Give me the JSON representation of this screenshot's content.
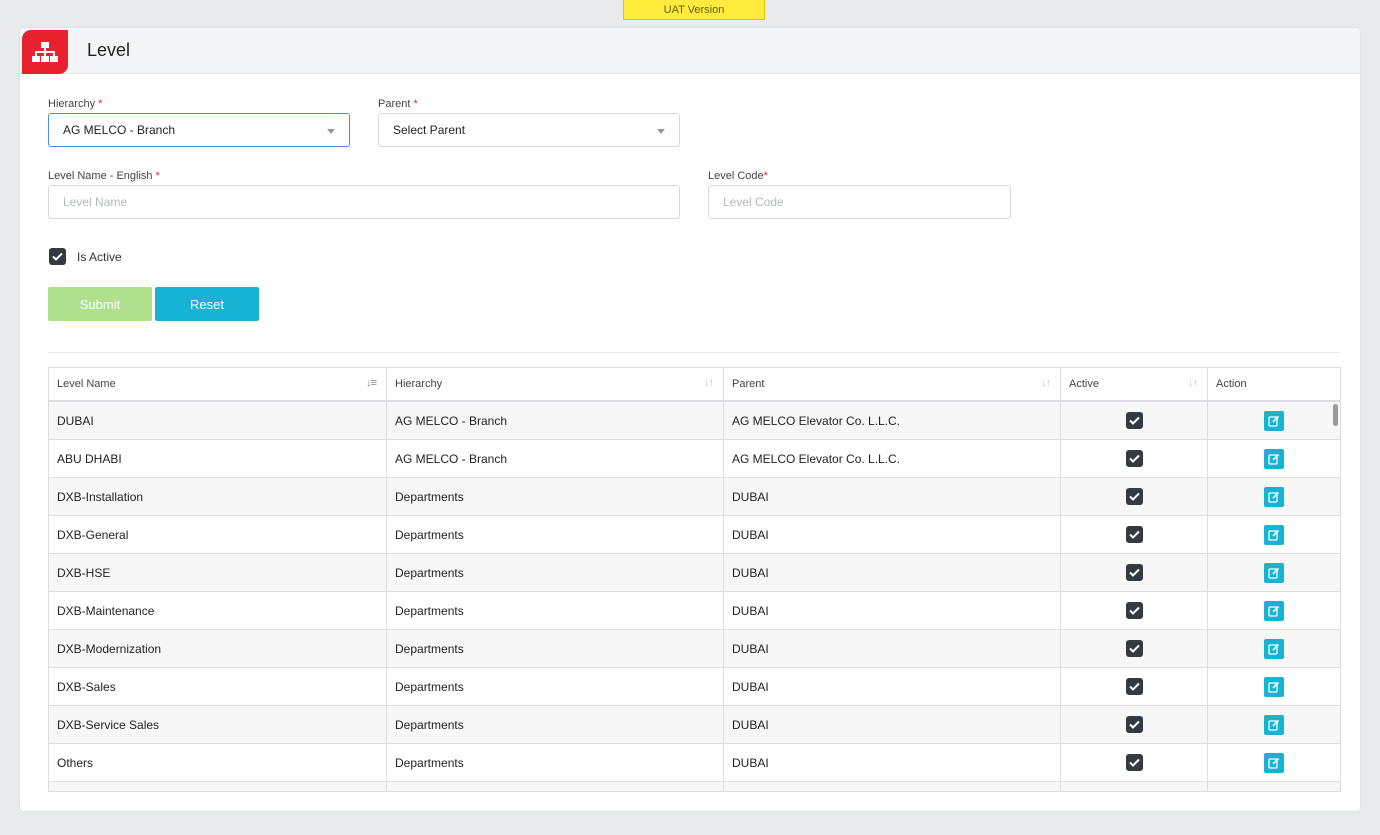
{
  "banner": {
    "text": "UAT Version"
  },
  "page": {
    "title": "Level",
    "icon": "sitemap-icon"
  },
  "form": {
    "hierarchy": {
      "label": "Hierarchy",
      "required_mark": "*",
      "value": "AG MELCO - Branch"
    },
    "parent": {
      "label": "Parent",
      "required_mark": "*",
      "value": "Select Parent"
    },
    "level_name": {
      "label": "Level Name - English",
      "required_mark": "*",
      "placeholder": "Level Name"
    },
    "level_code": {
      "label": "Level Code",
      "required_mark": "*",
      "placeholder": "Level Code"
    },
    "is_active": {
      "label": "Is Active",
      "checked": true
    },
    "submit_label": "Submit",
    "reset_label": "Reset"
  },
  "colors": {
    "brand_red": "#e8212e",
    "accent_cyan": "#17b3d5",
    "submit_green": "#aee08e",
    "banner_yellow": "#ffeb3b"
  },
  "table": {
    "columns": [
      {
        "label": "Level Name",
        "sort_icon": "sort-alpha-icon"
      },
      {
        "label": "Hierarchy",
        "sort_icon": "sort-icon"
      },
      {
        "label": "Parent",
        "sort_icon": "sort-icon"
      },
      {
        "label": "Active",
        "sort_icon": "sort-icon"
      },
      {
        "label": "Action"
      }
    ],
    "rows": [
      {
        "name": "DUBAI",
        "hierarchy": "AG MELCO - Branch",
        "parent": "AG MELCO Elevator Co. L.L.C.",
        "active": true
      },
      {
        "name": "ABU DHABI",
        "hierarchy": "AG MELCO - Branch",
        "parent": "AG MELCO Elevator Co. L.L.C.",
        "active": true
      },
      {
        "name": "DXB-Installation",
        "hierarchy": "Departments",
        "parent": "DUBAI",
        "active": true
      },
      {
        "name": "DXB-General",
        "hierarchy": "Departments",
        "parent": "DUBAI",
        "active": true
      },
      {
        "name": "DXB-HSE",
        "hierarchy": "Departments",
        "parent": "DUBAI",
        "active": true
      },
      {
        "name": "DXB-Maintenance",
        "hierarchy": "Departments",
        "parent": "DUBAI",
        "active": true
      },
      {
        "name": "DXB-Modernization",
        "hierarchy": "Departments",
        "parent": "DUBAI",
        "active": true
      },
      {
        "name": "DXB-Sales",
        "hierarchy": "Departments",
        "parent": "DUBAI",
        "active": true
      },
      {
        "name": "DXB-Service Sales",
        "hierarchy": "Departments",
        "parent": "DUBAI",
        "active": true
      },
      {
        "name": "Others",
        "hierarchy": "Departments",
        "parent": "DUBAI",
        "active": true
      },
      {
        "name": "",
        "hierarchy": "",
        "parent": "",
        "active": true
      }
    ]
  }
}
